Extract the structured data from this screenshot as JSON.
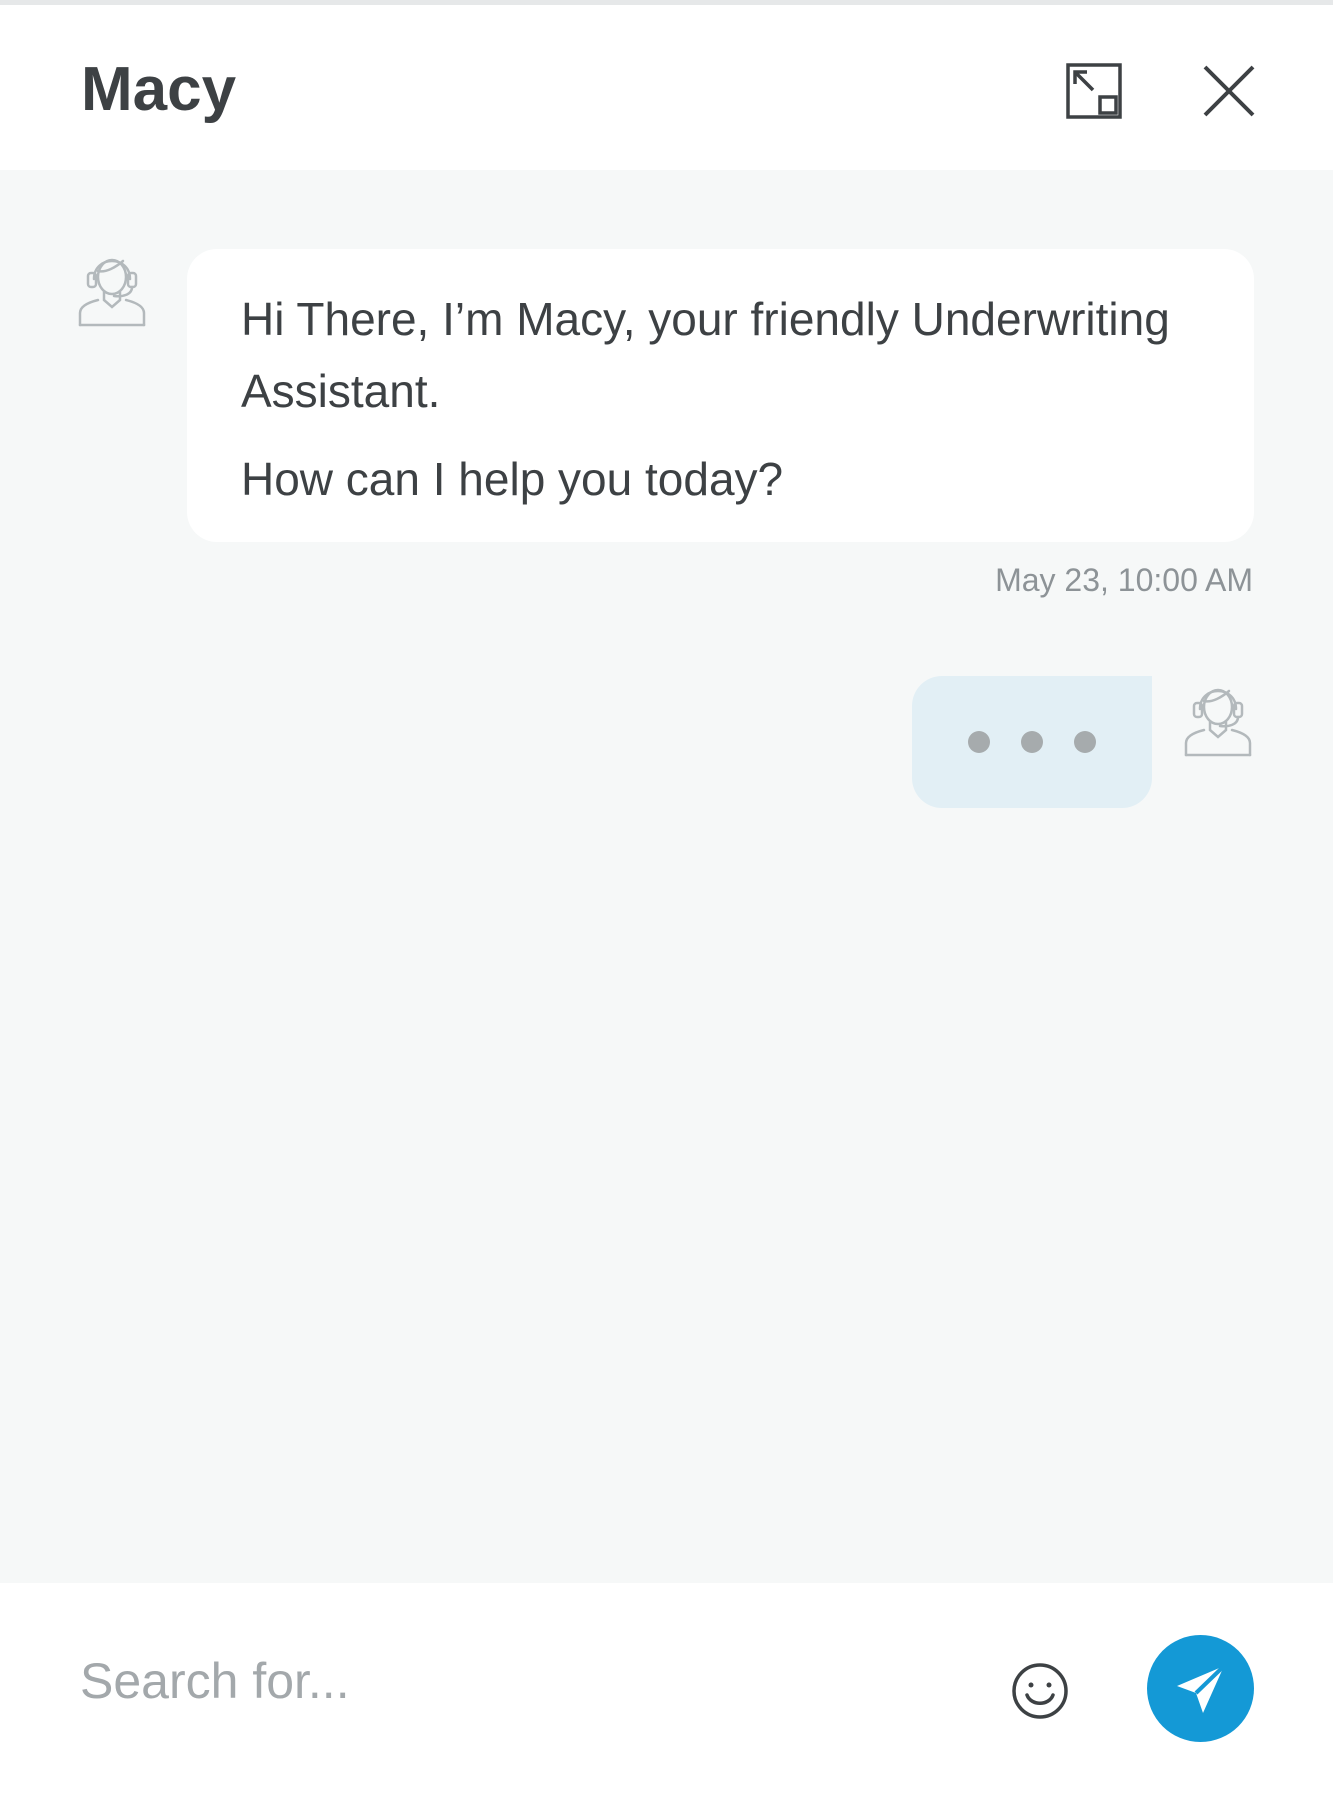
{
  "header": {
    "title": "Macy",
    "expand_icon": "expand-icon",
    "close_icon": "close-icon"
  },
  "conversation": {
    "messages": [
      {
        "sender": "bot",
        "avatar_icon": "agent-headset-icon",
        "lines": [
          "Hi There, I’m Macy, your friendly Underwriting Assistant.",
          "How can I help you today?"
        ],
        "timestamp": "May 23, 10:00 AM"
      }
    ],
    "typing_indicator": {
      "avatar_icon": "agent-headset-icon"
    }
  },
  "composer": {
    "placeholder": "Search for...",
    "value": "",
    "emoji_icon": "smiley-icon",
    "send_icon": "paper-plane-icon"
  },
  "colors": {
    "accent": "#1499d6",
    "title_text": "#3d4144",
    "conversation_bg": "#f6f8f8",
    "typing_bubble_bg": "#e2eff5"
  }
}
